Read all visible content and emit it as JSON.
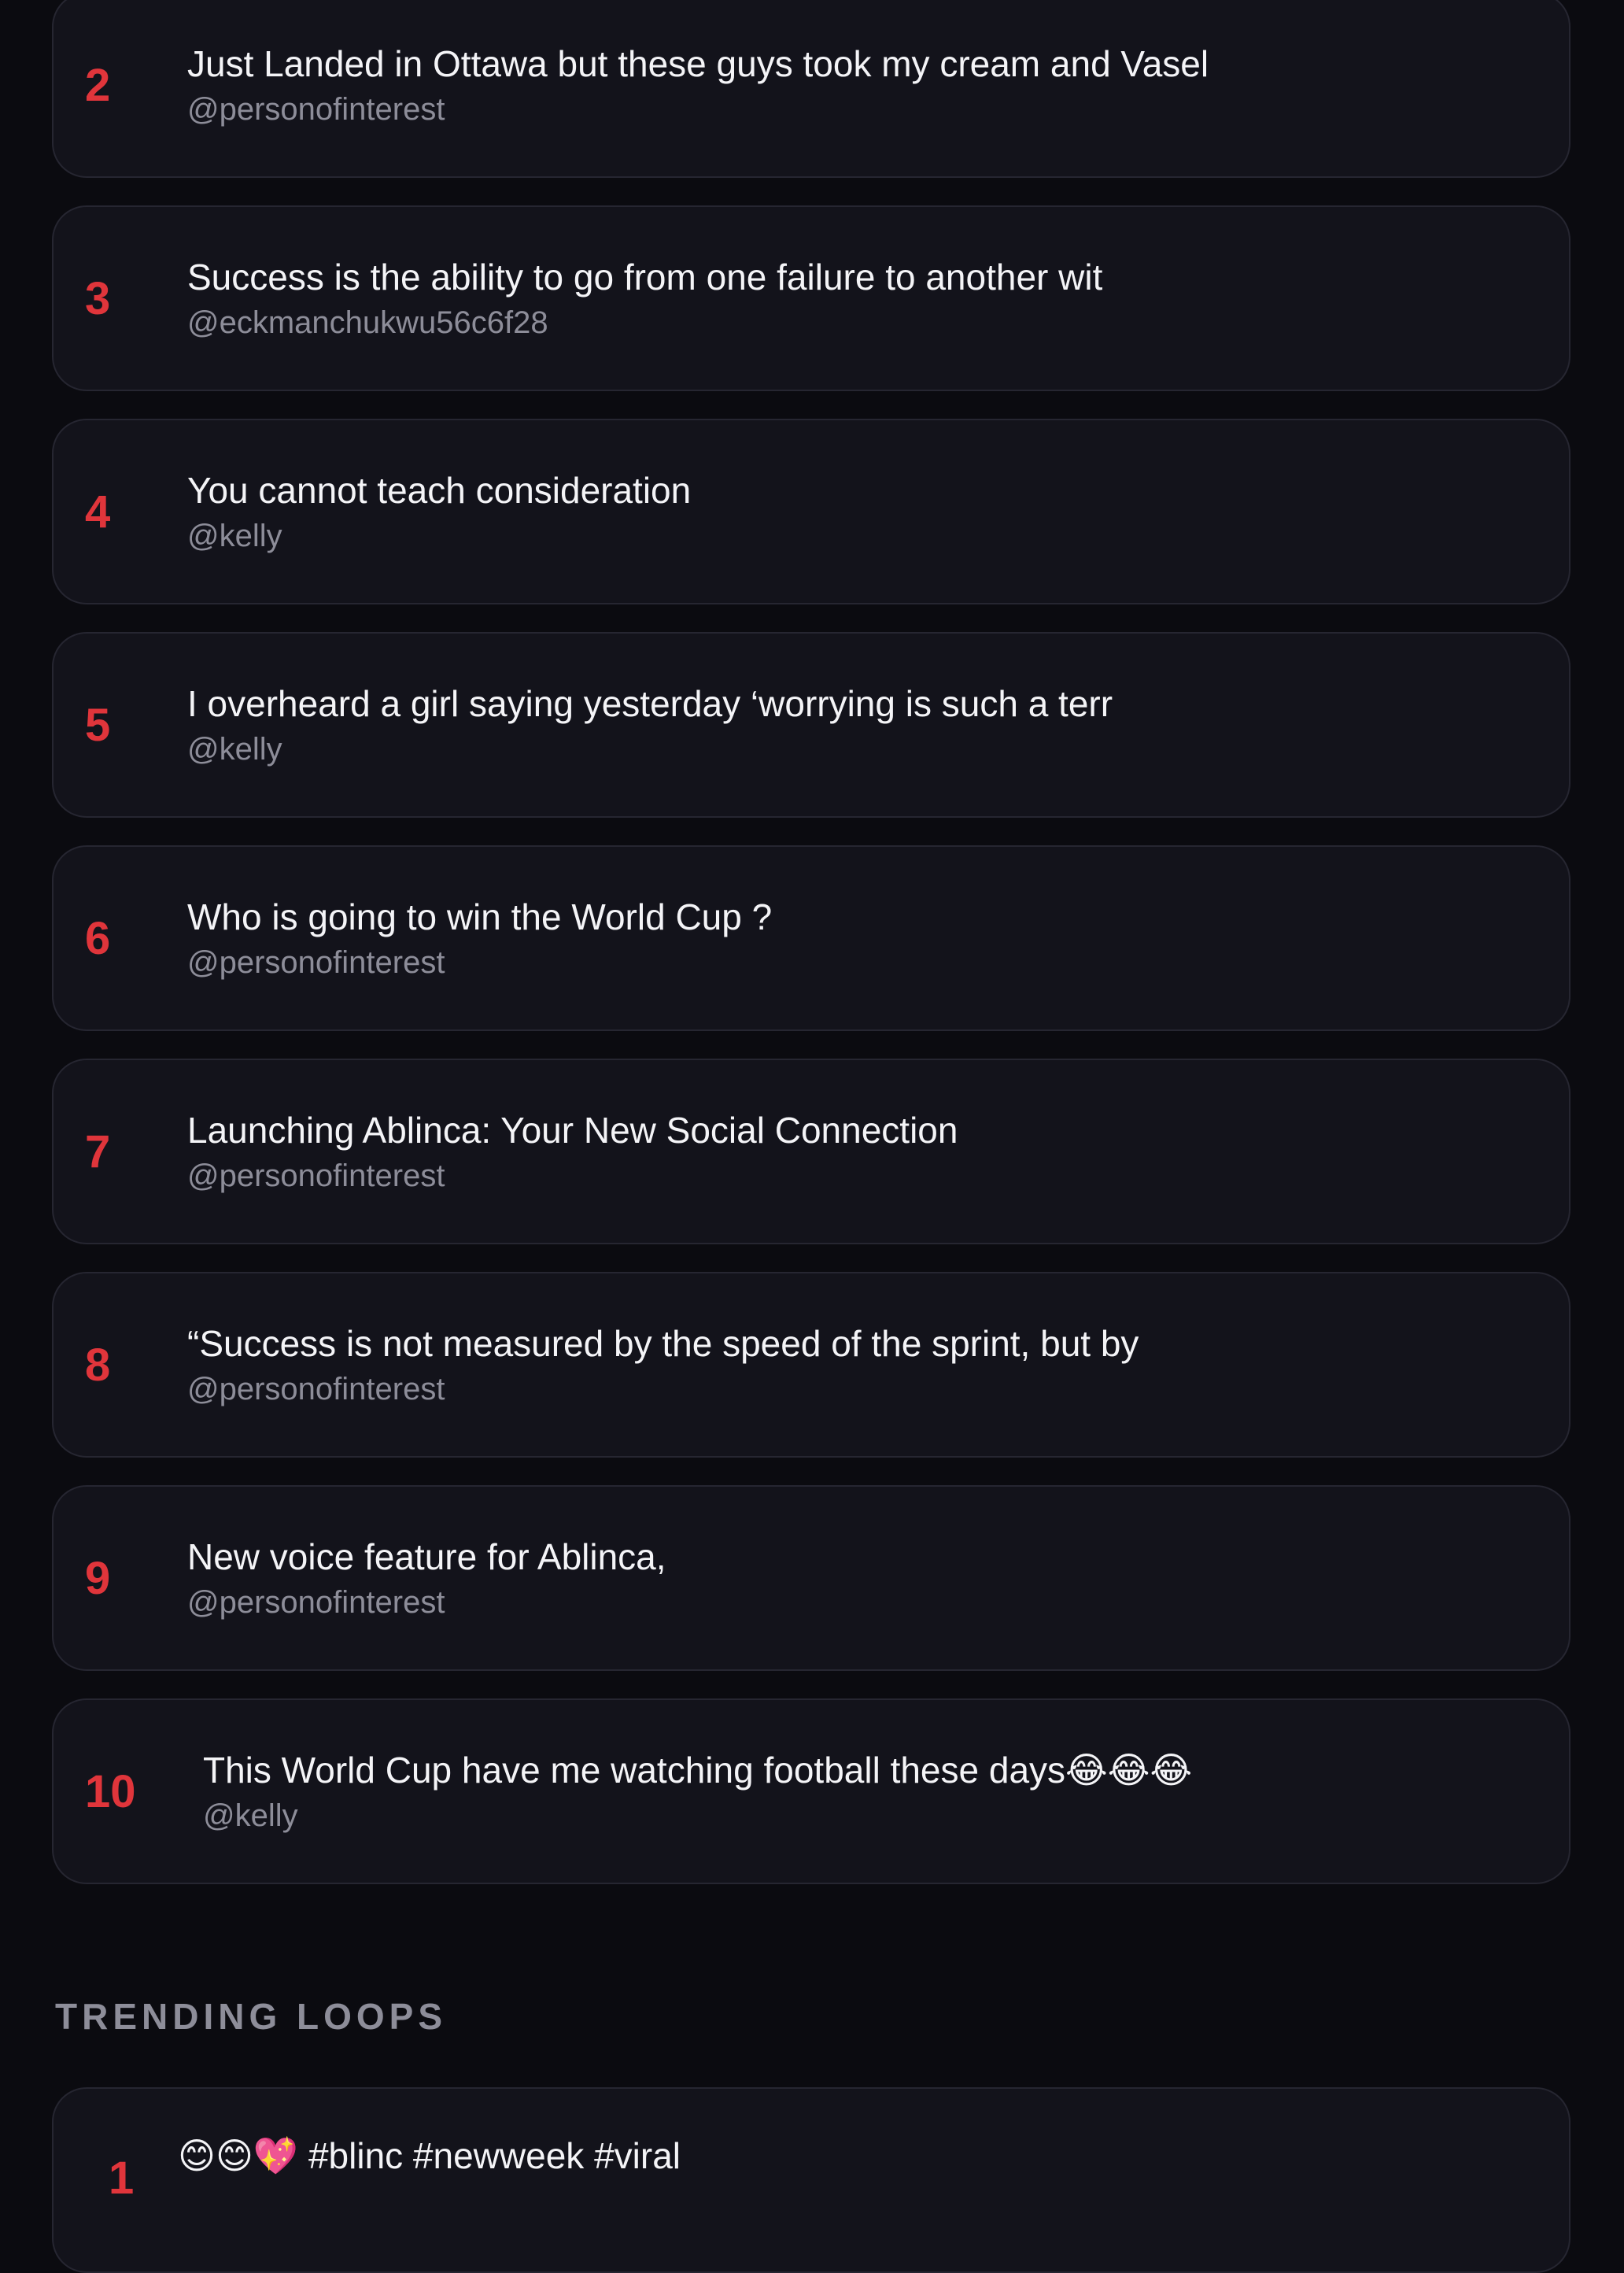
{
  "trending_posts": [
    {
      "rank": "2",
      "title": "Just Landed in Ottawa but these guys took my cream and Vasel",
      "handle": "@personofinterest"
    },
    {
      "rank": "3",
      "title": "Success is the ability to go from one failure to another wit",
      "handle": "@eckmanchukwu56c6f28"
    },
    {
      "rank": "4",
      "title": "You cannot teach consideration",
      "handle": "@kelly"
    },
    {
      "rank": "5",
      "title": "I overheard a girl saying yesterday ‘worrying is such a terr",
      "handle": "@kelly"
    },
    {
      "rank": "6",
      "title": "Who is going to win the World Cup ?",
      "handle": "@personofinterest"
    },
    {
      "rank": "7",
      "title": "Launching Ablinca: Your New Social Connection",
      "handle": "@personofinterest"
    },
    {
      "rank": "8",
      "title": "“Success is not measured by the speed of the sprint, but by",
      "handle": "@personofinterest"
    },
    {
      "rank": "9",
      "title": "New voice feature for Ablinca,",
      "handle": "@personofinterest"
    },
    {
      "rank": "10",
      "title": "This World Cup have me watching football these days😂😂😂",
      "handle": "@kelly"
    }
  ],
  "trending_loops": {
    "section_title": "TRENDING LOOPS",
    "first_item": {
      "rank": "1",
      "text": "😊😊💖 #blinc #newweek #viral"
    }
  },
  "colors": {
    "background": "#0b0b10",
    "card": "#13131b",
    "card_border": "#262631",
    "rank": "#e0353b",
    "handle": "#8d8d99"
  }
}
